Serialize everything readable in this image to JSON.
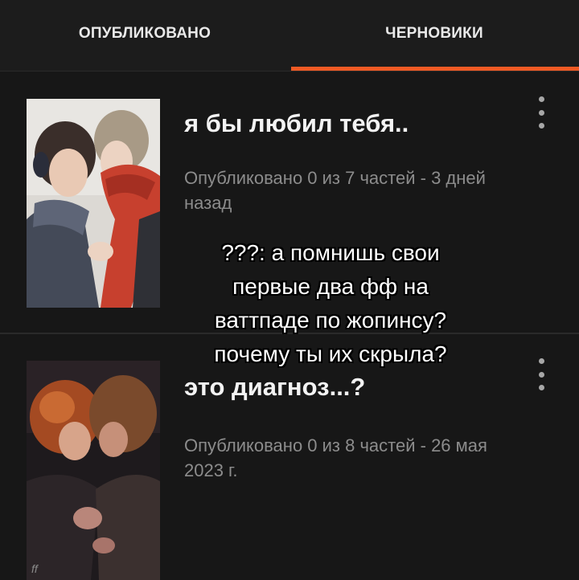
{
  "tabs": {
    "published_label": "ОПУБЛИКОВАНО",
    "drafts_label": "ЧЕРНОВИКИ",
    "active": "drafts",
    "accent_color": "#f05a24"
  },
  "stories": [
    {
      "title": "я бы любил тебя..",
      "status": "Опубликовано 0 из 7 частей - 3 дней назад",
      "cover": "illustration of two people, one wearing a red scarf"
    },
    {
      "title": "это диагноз...?",
      "status": "Опубликовано 0 из 8 частей - 26 мая 2023 г.",
      "cover": "dark illustration of two people embracing",
      "cover_signature": "ff"
    }
  ],
  "overlay_caption": {
    "lines": [
      "???: а помнишь свои",
      "первые два фф на",
      "ваттпаде по жопинсу?",
      "почему ты их скрыла?"
    ]
  }
}
